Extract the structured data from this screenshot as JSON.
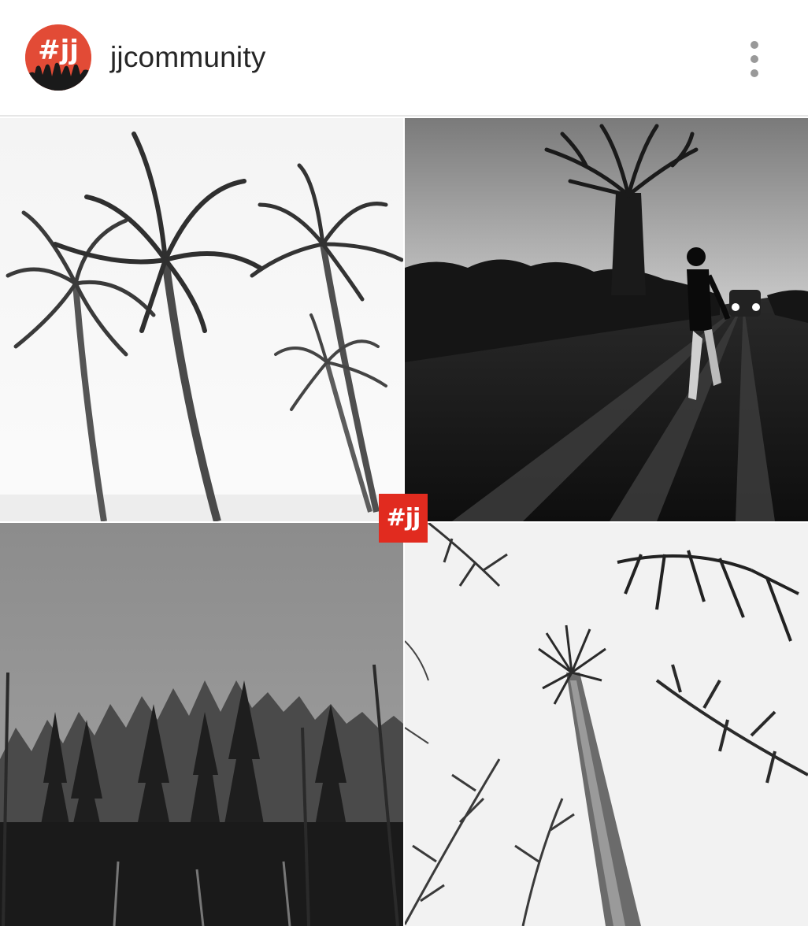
{
  "post": {
    "username": "jjcommunity",
    "avatar_icon": "jj-logo-avatar",
    "more_icon": "more-vertical-icon",
    "accent_color": "#e12b1f"
  },
  "collage": {
    "badge_text": "#jj",
    "tiles": [
      {
        "subject": "palm-trees-photo"
      },
      {
        "subject": "baobab-road-runner-photo"
      },
      {
        "subject": "pine-forest-photo"
      },
      {
        "subject": "tall-trees-looking-up-photo"
      }
    ]
  }
}
